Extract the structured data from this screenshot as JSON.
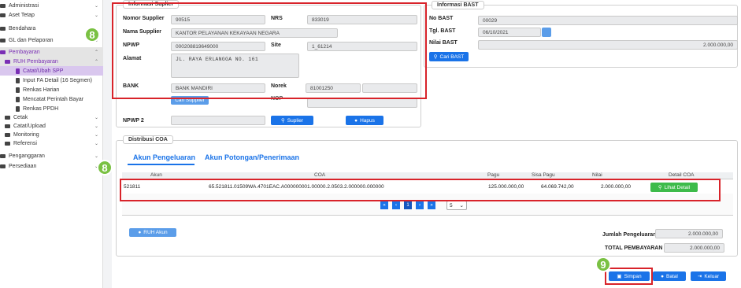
{
  "sidebar": {
    "items": [
      {
        "label": "Administrasi"
      },
      {
        "label": "Aset Tetap"
      },
      {
        "label": "Bendahara"
      },
      {
        "label": "GL dan Pelaporan"
      },
      {
        "label": "Pembayaran"
      },
      {
        "label": "RUH Pembayaran"
      },
      {
        "label": "Catat/Ubah SPP"
      },
      {
        "label": "Input FA Detail (16 Segmen)"
      },
      {
        "label": "Renkas Harian"
      },
      {
        "label": "Mencatat Perintah Bayar"
      },
      {
        "label": "Renkas PPDH"
      },
      {
        "label": "Cetak"
      },
      {
        "label": "Catat/Upload"
      },
      {
        "label": "Monitoring"
      },
      {
        "label": "Referensi"
      },
      {
        "label": "Penganggaran"
      },
      {
        "label": "Persediaan"
      }
    ],
    "chevron_down": "⌄",
    "chevron_up": "⌃"
  },
  "supplier": {
    "legend": "Informasi Suplier",
    "nomor_label": "Nomor Supplier",
    "nomor_value": "90515",
    "nrs_label": "NRS",
    "nrs_value": "833019",
    "nama_label": "Nama Supplier",
    "nama_value": "KANTOR PELAYANAN KEKAYAAN NEGARA",
    "npwp_label": "NPWP",
    "npwp_value": "000208819649000",
    "site_label": "Site",
    "site_value": "1_61214",
    "alamat_label": "Alamat",
    "alamat_value": "JL. RAYA ERLANGGA NO. 161",
    "bank_label": "BANK",
    "bank_value": "BANK MANDIRI",
    "norek_label": "Norek",
    "norek_value": "81001250",
    "cari_button": "Cari Supplier",
    "nop_label": "NOP",
    "npwp2_label": "NPWP 2",
    "suplier_button": "Suplier",
    "hapus_button": "Hapus"
  },
  "bast": {
    "legend": "Informasi BAST",
    "no_label": "No BAST",
    "no_value": "00029",
    "tgl_label": "Tgl. BAST",
    "tgl_value": "06/10/2021",
    "nilai_label": "Nilai BAST",
    "nilai_value": "2.000.000,00",
    "cari_button": "Cari BAST"
  },
  "coa": {
    "legend": "Distribusi COA",
    "tabs": [
      {
        "label": "Akun Pengeluaran"
      },
      {
        "label": "Akun Potongan/Penerimaan"
      }
    ],
    "headers": {
      "akun": "Akun",
      "coa": "COA",
      "pagu": "Pagu",
      "sisa": "Sisa Pagu",
      "nilai": "Nilai",
      "detail": "Detail COA"
    },
    "rows": [
      {
        "akun": "521811",
        "coa": "65.521811.01509WA.4701EAC.A000000001.00000.2.0503.2.000000.000000",
        "pagu": "125.000.000,00",
        "sisa": "64.069.742,00",
        "nilai": "2.000.000,00",
        "detail": "Lihat Detail"
      }
    ],
    "pagination": {
      "first": "«",
      "prev": "‹",
      "page": "1",
      "next": "›",
      "last": "»",
      "size": "5"
    },
    "ruh_button": "RUH Akun",
    "jumlah_label": "Jumlah Pengeluaran",
    "jumlah_value": "2.000.000,00",
    "total_label": "TOTAL PEMBAYARAN",
    "total_value": "2.000.000,00"
  },
  "footer": {
    "simpan": "Simpan",
    "batal": "Batal",
    "keluar": "Keluar"
  },
  "annotations": {
    "badge_supplier": "8",
    "badge_row": "8",
    "badge_simpan": "9"
  },
  "colors": {
    "accent": "#1a73e8",
    "sidebar_active": "#7a2fb5",
    "annotation": "#d8232a",
    "badge": "#7ac143"
  }
}
